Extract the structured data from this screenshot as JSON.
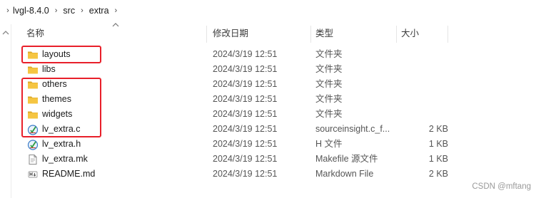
{
  "breadcrumb": {
    "items": [
      "lvgl-8.4.0",
      "src",
      "extra"
    ]
  },
  "columns": {
    "name": "名称",
    "date": "修改日期",
    "type": "类型",
    "size": "大小"
  },
  "files": [
    {
      "name": "layouts",
      "date": "2024/3/19 12:51",
      "type": "文件夹",
      "size": "",
      "icon": "folder-icon"
    },
    {
      "name": "libs",
      "date": "2024/3/19 12:51",
      "type": "文件夹",
      "size": "",
      "icon": "folder-icon"
    },
    {
      "name": "others",
      "date": "2024/3/19 12:51",
      "type": "文件夹",
      "size": "",
      "icon": "folder-icon"
    },
    {
      "name": "themes",
      "date": "2024/3/19 12:51",
      "type": "文件夹",
      "size": "",
      "icon": "folder-icon"
    },
    {
      "name": "widgets",
      "date": "2024/3/19 12:51",
      "type": "文件夹",
      "size": "",
      "icon": "folder-icon"
    },
    {
      "name": "lv_extra.c",
      "date": "2024/3/19 12:51",
      "type": "sourceinsight.c_f...",
      "size": "2 KB",
      "icon": "c-source-file-icon"
    },
    {
      "name": "lv_extra.h",
      "date": "2024/3/19 12:51",
      "type": "H 文件",
      "size": "1 KB",
      "icon": "header-file-icon"
    },
    {
      "name": "lv_extra.mk",
      "date": "2024/3/19 12:51",
      "type": "Makefile 源文件",
      "size": "1 KB",
      "icon": "makefile-icon"
    },
    {
      "name": "README.md",
      "date": "2024/3/19 12:51",
      "type": "Markdown File",
      "size": "2 KB",
      "icon": "markdown-file-icon"
    }
  ],
  "watermark": "CSDN @mftang",
  "colors": {
    "highlight": "#e8202a",
    "folder": "#f5c542",
    "folder_dark": "#dca928"
  }
}
